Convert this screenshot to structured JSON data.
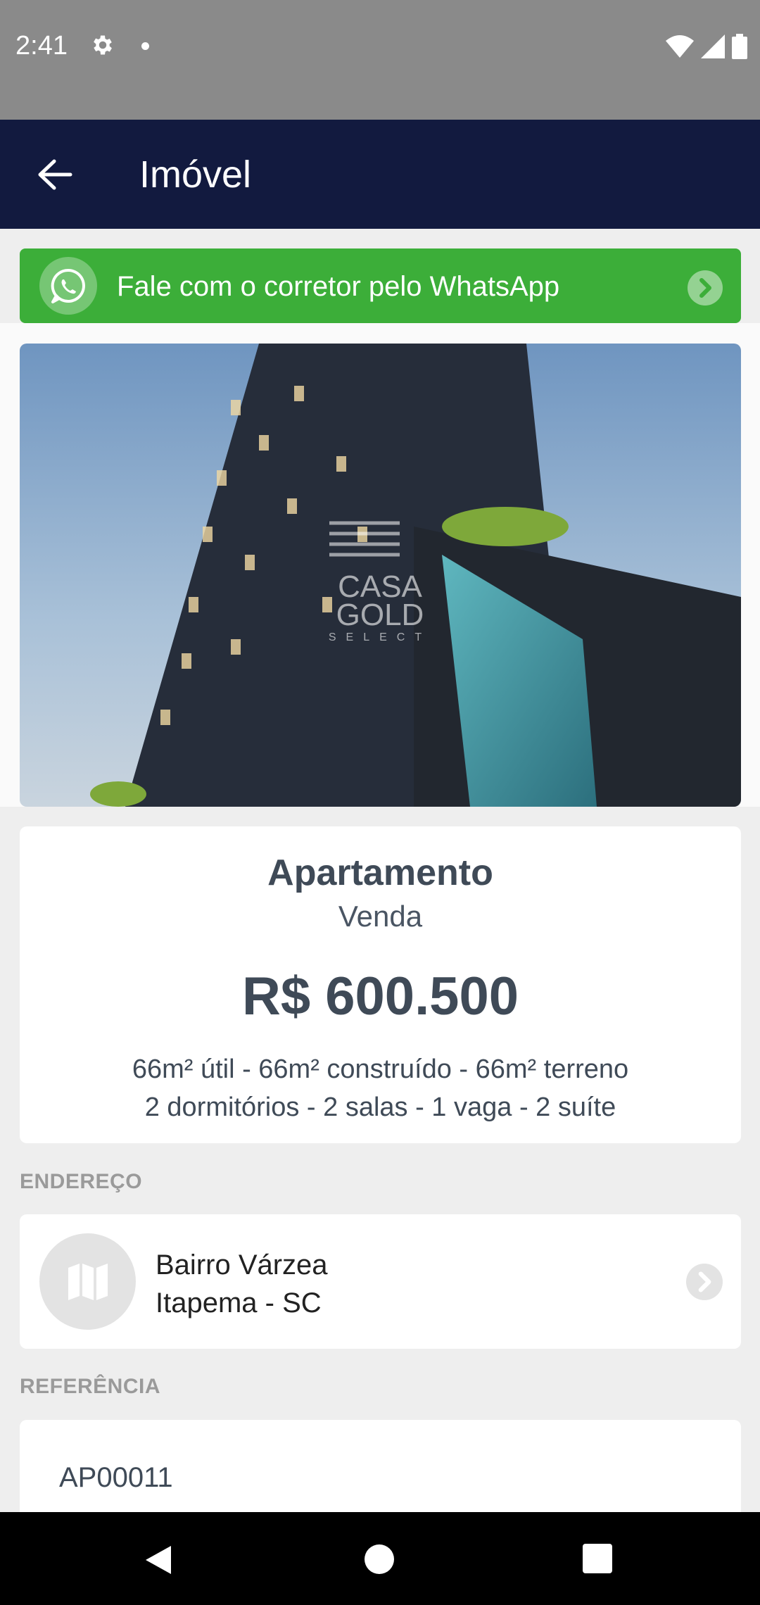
{
  "status_bar": {
    "time": "2:41"
  },
  "app_bar": {
    "title": "Imóvel"
  },
  "whatsapp_banner": {
    "label": "Fale com o corretor pelo WhatsApp",
    "color": "#3cae39"
  },
  "photo": {
    "watermark_line1": "CASA",
    "watermark_line2": "GOLD",
    "watermark_line3": "SELECT"
  },
  "property": {
    "type": "Apartamento",
    "deal": "Venda",
    "price": "R$ 600.500",
    "areas": "66m² útil - 66m² construído - 66m² terreno",
    "rooms": "2 dormitórios - 2 salas - 1 vaga - 2 suíte"
  },
  "address": {
    "section_label": "ENDEREÇO",
    "line1": "Bairro Várzea",
    "line2": "Itapema - SC"
  },
  "reference": {
    "section_label": "REFERÊNCIA",
    "code": "AP00011"
  },
  "colors": {
    "app_bar": "#121a3f",
    "text_dark": "#3f4a57"
  }
}
